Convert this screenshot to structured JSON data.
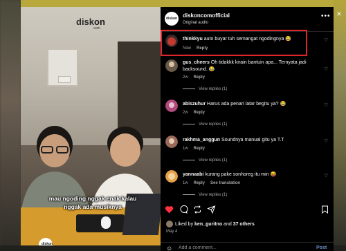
{
  "background": {
    "accent": "#b9a83c"
  },
  "video": {
    "logo_text_a": "disk",
    "logo_text_b": "on",
    "logo_sub": ".com",
    "caption_line1": "mau ngoding nggak enak kalau",
    "caption_line2": "nggak ada musiknya",
    "badge_text": "diskon"
  },
  "post": {
    "username": "diskoncomofficial",
    "audio": "Original audio",
    "more_icon": "more-horizontal-icon"
  },
  "comments": [
    {
      "user": "thinkkyu",
      "text": "auto buyar tuh semangat ngodingnya 😂",
      "time": "Now",
      "reply": "Reply",
      "avatar_color": "#c23a2e",
      "view_replies": ""
    },
    {
      "user": "gus_cheers",
      "text": "Oh tidakkk kirain bantuin apa... Ternyata jadi backsound. 😂",
      "time": "2w",
      "reply": "Reply",
      "avatar_color": "#6a5a4a",
      "view_replies": "View replies (1)"
    },
    {
      "user": "abiszuhur",
      "text": "Harus ada penari latar begitu ya? 😂",
      "time": "2w",
      "reply": "Reply",
      "avatar_color": "#b04a7a",
      "view_replies": "View replies (1)"
    },
    {
      "user": "rakhma_anggun",
      "text": "Soundnya manual gitu ya T.T",
      "time": "1w",
      "reply": "Reply",
      "avatar_color": "#9a6a5a",
      "view_replies": "View replies (1)"
    },
    {
      "user": "yannaabi",
      "text": "kurang pake sonhoreg itu min 😝",
      "time": "1w",
      "reply": "Reply",
      "see_translation": "See translation",
      "avatar_color": "#e2a04a",
      "view_replies": "View replies (1)"
    }
  ],
  "likes": {
    "prefix": "Liked by",
    "user": "ken_guritno",
    "and": "and",
    "count": "37 others"
  },
  "date": "May 4",
  "add_comment": {
    "placeholder": "Add a comment...",
    "post": "Post"
  },
  "close_icon": "×",
  "emoji_icon": "☺",
  "heart_icon": "♡"
}
